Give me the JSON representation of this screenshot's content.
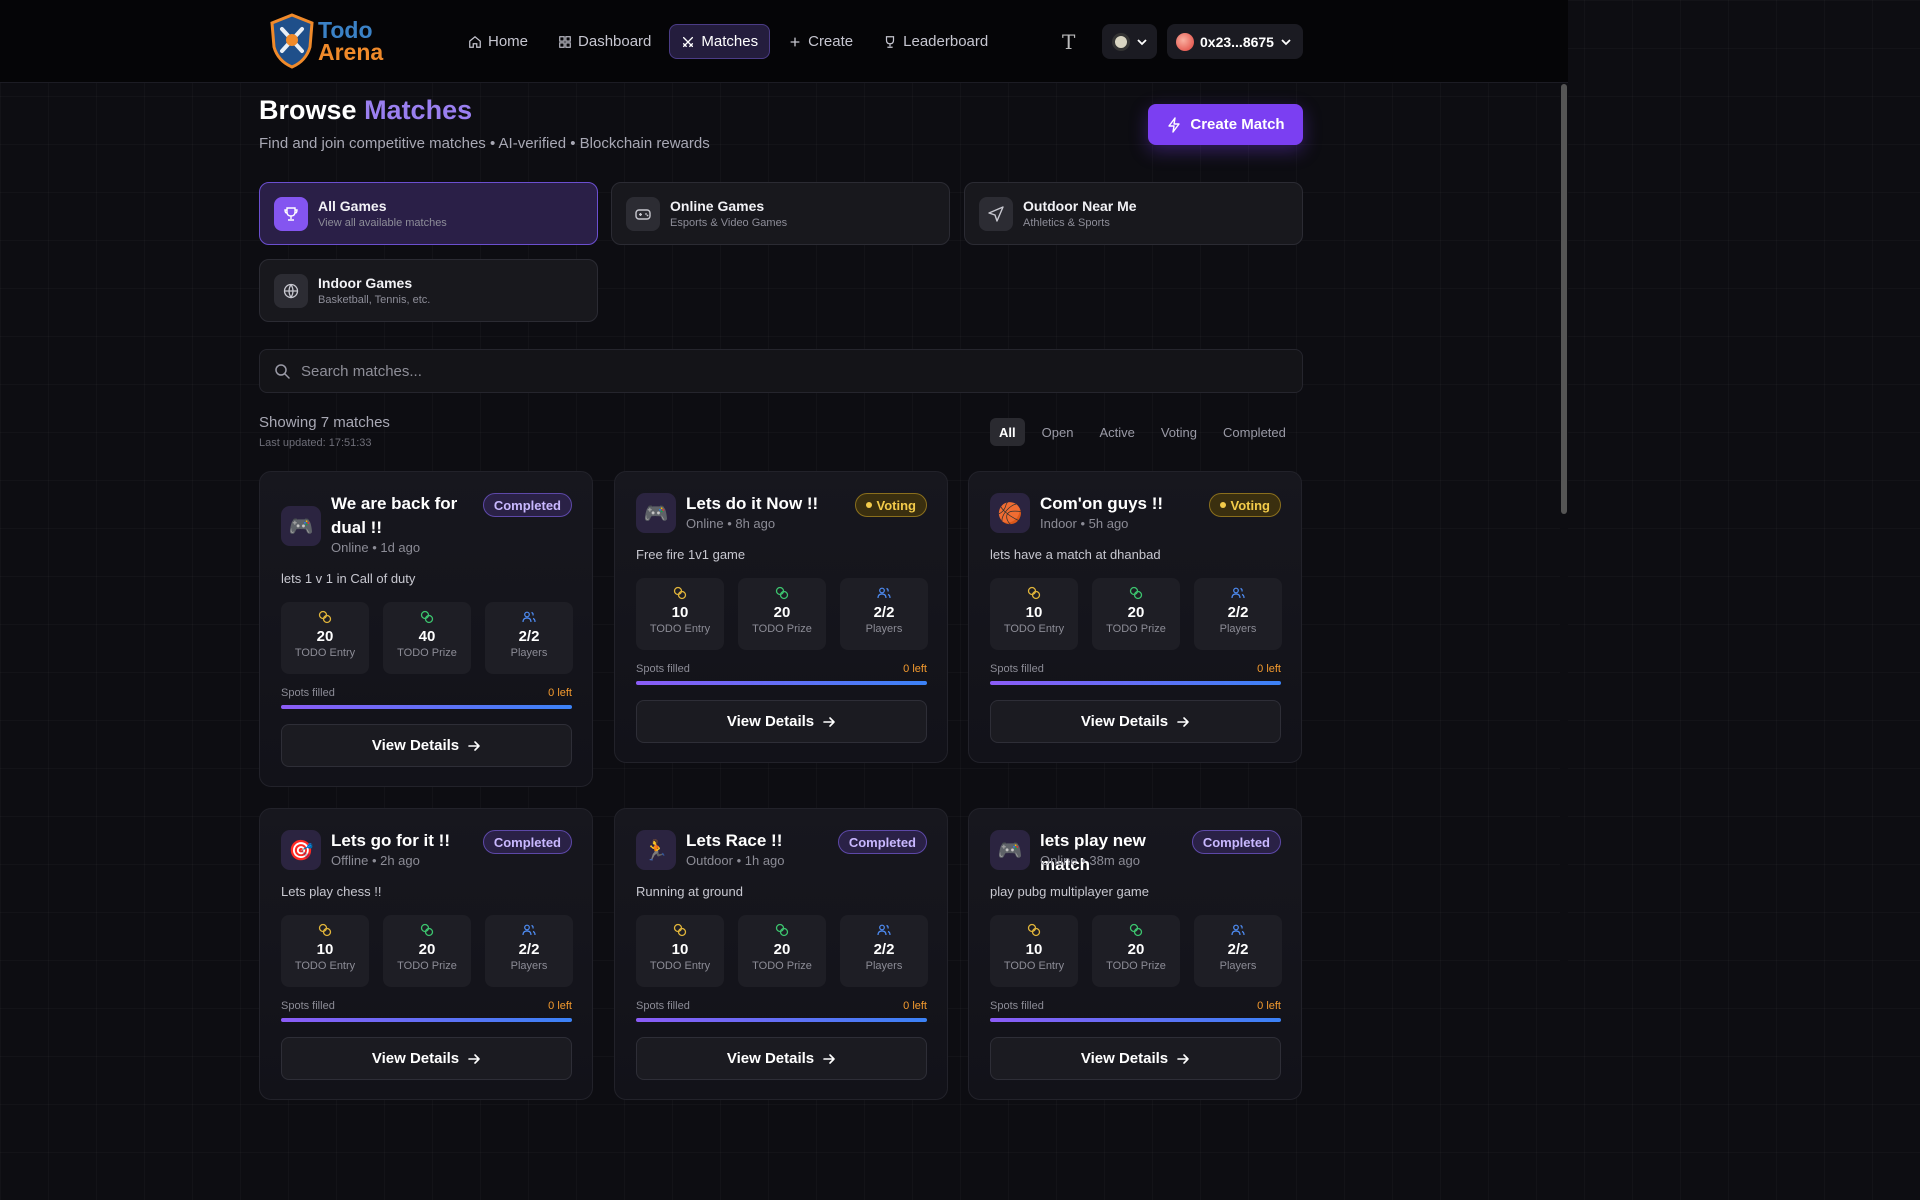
{
  "brand": {
    "line1": "Todo",
    "line2": "Arena"
  },
  "nav": [
    {
      "label": "Home",
      "icon": "home-icon"
    },
    {
      "label": "Dashboard",
      "icon": "dashboard-icon"
    },
    {
      "label": "Matches",
      "icon": "swords-icon",
      "active": true
    },
    {
      "label": "Create",
      "icon": "plus-icon"
    },
    {
      "label": "Leaderboard",
      "icon": "trophy-icon"
    }
  ],
  "header": {
    "theme_icon": "T",
    "wallet": "0x23...8675"
  },
  "page": {
    "title": "Browse",
    "title_accent": "Matches",
    "subtitle": "Find and join competitive matches • AI-verified • Blockchain rewards",
    "create_label": "Create Match"
  },
  "categories": [
    {
      "title": "All Games",
      "sub": "View all available matches",
      "icon": "trophy-icon",
      "active": true
    },
    {
      "title": "Online Games",
      "sub": "Esports & Video Games",
      "icon": "gamepad-icon"
    },
    {
      "title": "Outdoor Near Me",
      "sub": "Athletics & Sports",
      "icon": "navigation-icon"
    },
    {
      "title": "Indoor Games",
      "sub": "Basketball, Tennis, etc.",
      "icon": "globe-icon"
    }
  ],
  "search": {
    "placeholder": "Search matches..."
  },
  "results": {
    "showing": "Showing 7 matches",
    "updated": "Last updated: 17:51:33"
  },
  "filters": [
    {
      "label": "All",
      "active": true
    },
    {
      "label": "Open"
    },
    {
      "label": "Active"
    },
    {
      "label": "Voting"
    },
    {
      "label": "Completed"
    }
  ],
  "labels": {
    "entry": "TODO Entry",
    "prize": "TODO Prize",
    "players": "Players",
    "spots": "Spots filled",
    "view": "View Details"
  },
  "matches": [
    {
      "title": "We are back for dual !!",
      "meta": "Online • 1d ago",
      "status": "Completed",
      "desc": "lets 1 v 1 in Call of duty",
      "entry": "20",
      "prize": "40",
      "players": "2/2",
      "left": "0 left",
      "fill": 1.0,
      "emoji": "🎮"
    },
    {
      "title": "Lets do it Now !!",
      "meta": "Online • 8h ago",
      "status": "Voting",
      "desc": "Free fire 1v1 game",
      "entry": "10",
      "prize": "20",
      "players": "2/2",
      "left": "0 left",
      "fill": 1.0,
      "emoji": "🎮"
    },
    {
      "title": "Com'on guys !!",
      "meta": "Indoor • 5h ago",
      "status": "Voting",
      "desc": "lets have a match at dhanbad",
      "entry": "10",
      "prize": "20",
      "players": "2/2",
      "left": "0 left",
      "fill": 1.0,
      "emoji": "🏀"
    },
    {
      "title": "Lets go for it !!",
      "meta": "Offline • 2h ago",
      "status": "Completed",
      "desc": "Lets play chess !!",
      "entry": "10",
      "prize": "20",
      "players": "2/2",
      "left": "0 left",
      "fill": 1.0,
      "emoji": "🎯"
    },
    {
      "title": "Lets Race !!",
      "meta": "Outdoor • 1h ago",
      "status": "Completed",
      "desc": "Running at ground",
      "entry": "10",
      "prize": "20",
      "players": "2/2",
      "left": "0 left",
      "fill": 1.0,
      "emoji": "🏃"
    },
    {
      "title": "lets play new match",
      "meta": "Online • 38m ago",
      "status": "Completed",
      "desc": "play pubg multiplayer game",
      "entry": "10",
      "prize": "20",
      "players": "2/2",
      "left": "0 left",
      "fill": 1.0,
      "emoji": "🎮"
    }
  ]
}
